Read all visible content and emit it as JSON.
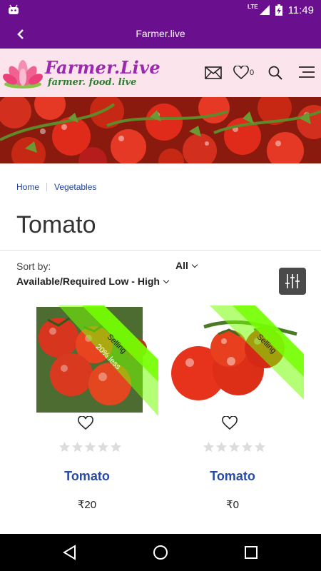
{
  "status_bar": {
    "network": "LTE",
    "time": "11:49"
  },
  "app_bar": {
    "title": "Farmer.live"
  },
  "site_header": {
    "logo_name": "Farmer.Live",
    "logo_tagline": "farmer. food. live",
    "wishlist_count": "0"
  },
  "breadcrumb": {
    "items": [
      "Home",
      "Vegetables"
    ]
  },
  "page": {
    "title": "Tomato"
  },
  "sort": {
    "label": "Sort by:",
    "value": "Available/Required Low - High",
    "filter_value": "All"
  },
  "products": [
    {
      "name": "Tomato",
      "price": "₹20",
      "ribbon": "Selling",
      "discount": "20% less",
      "rating": 0
    },
    {
      "name": "Tomato",
      "price": "₹0",
      "ribbon": "Selling",
      "discount": "",
      "rating": 0
    }
  ],
  "colors": {
    "brand": "#6a0f8e",
    "header_bg": "#fce4ec",
    "ribbon": "#76ff03",
    "link": "#2a4aa8"
  }
}
